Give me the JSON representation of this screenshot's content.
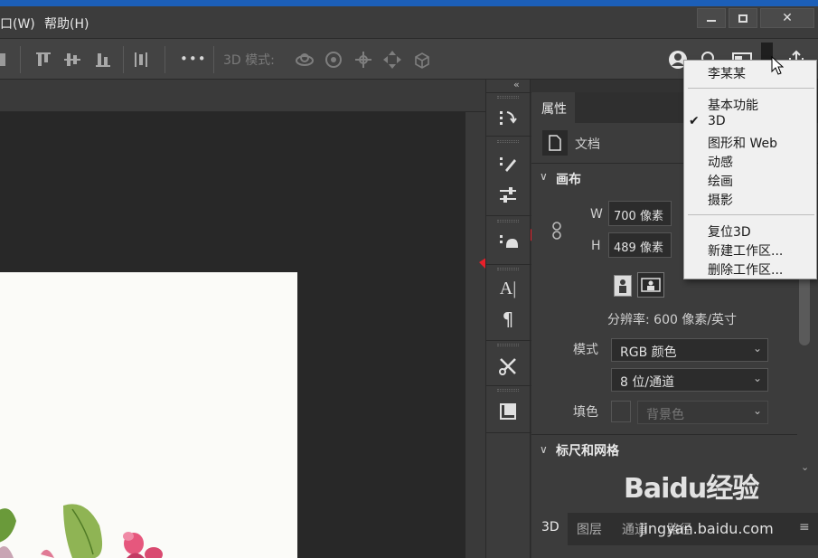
{
  "menubar": {
    "items": [
      "口(W)",
      "帮助(H)"
    ],
    "window_controls": [
      "minimize",
      "restore",
      "close"
    ]
  },
  "options_bar": {
    "mode_3d_label": "3D 模式:",
    "more_label": "•••"
  },
  "panel": {
    "collapse_label": "«",
    "tab_active": "属性",
    "doc_label": "文档",
    "canvas_section": "画布",
    "width_label": "W",
    "width_value": "700 像素",
    "height_label": "H",
    "height_value": "489 像素",
    "resolution": "分辨率: 600 像素/英寸",
    "mode_label": "模式",
    "mode_value": "RGB 颜色",
    "bitdepth_value": "8 位/通道",
    "fill_label": "填色",
    "fill_value": "背景色",
    "rulers_section": "标尺和网格"
  },
  "bottom_tabs": {
    "items": [
      "3D",
      "图层",
      "通道",
      "路径"
    ]
  },
  "dropdown": {
    "user": "李某某",
    "workspaces": [
      {
        "label": "基本功能",
        "checked": false
      },
      {
        "label": "3D",
        "checked": true
      },
      {
        "label": "图形和 Web",
        "checked": false
      },
      {
        "label": "动感",
        "checked": false
      },
      {
        "label": "绘画",
        "checked": false
      },
      {
        "label": "摄影",
        "checked": false
      }
    ],
    "actions": [
      "复位3D",
      "新建工作区...",
      "删除工作区..."
    ]
  },
  "watermark": {
    "logo": "Baidu经验",
    "url": "jingyan.baidu.com"
  },
  "colors": {
    "accent_red": "#e8202a",
    "panel_bg": "#3c3c3c",
    "menu_bg": "#f0f0f0"
  }
}
